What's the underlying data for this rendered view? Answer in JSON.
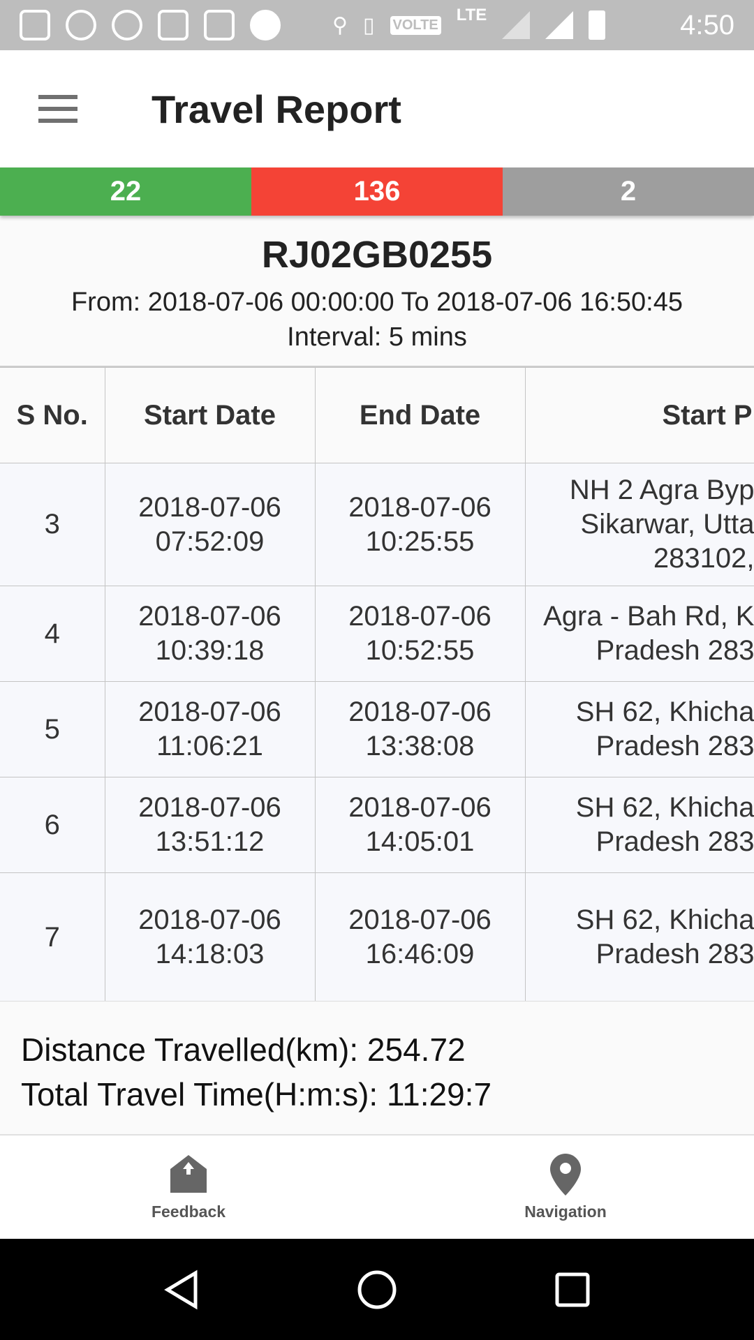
{
  "status_bar": {
    "time": "4:50",
    "network": "LTE",
    "volte": "VOLTE"
  },
  "toolbar": {
    "title": "Travel Report",
    "menu_icon": "hamburger-icon"
  },
  "stats": [
    {
      "value": "22",
      "color": "#4caf50"
    },
    {
      "value": "136",
      "color": "#f44336"
    },
    {
      "value": "2",
      "color": "#9e9e9e"
    }
  ],
  "info": {
    "plate": "RJ02GB0255",
    "range": "From: 2018-07-06 00:00:00 To 2018-07-06 16:50:45",
    "interval": "Interval: 5 mins"
  },
  "table": {
    "headers": [
      "S No.",
      "Start Date",
      "End Date",
      "Start P"
    ],
    "rows": [
      {
        "sno": "3",
        "start": "2018-07-06\n07:52:09",
        "end": "2018-07-06\n10:25:55",
        "loc": "NH 2 Agra Byp\nSikarwar, Utta\n283102,"
      },
      {
        "sno": "4",
        "start": "2018-07-06\n10:39:18",
        "end": "2018-07-06\n10:52:55",
        "loc": "Agra - Bah Rd, K\nPradesh 283"
      },
      {
        "sno": "5",
        "start": "2018-07-06\n11:06:21",
        "end": "2018-07-06\n13:38:08",
        "loc": "SH 62, Khicha\nPradesh 283"
      },
      {
        "sno": "6",
        "start": "2018-07-06\n13:51:12",
        "end": "2018-07-06\n14:05:01",
        "loc": "SH 62, Khicha\nPradesh 283"
      },
      {
        "sno": "7",
        "start": "2018-07-06\n14:18:03",
        "end": "2018-07-06\n16:46:09",
        "loc": "SH 62, Khicha\nPradesh 283"
      }
    ]
  },
  "summary": {
    "distance": "Distance Travelled(km): 254.72",
    "time": "Total Travel Time(H:m:s): 11:29:7"
  },
  "bottom_nav": [
    {
      "label": "Feedback",
      "icon": "feedback-icon"
    },
    {
      "label": "Navigation",
      "icon": "location-pin-icon"
    }
  ]
}
